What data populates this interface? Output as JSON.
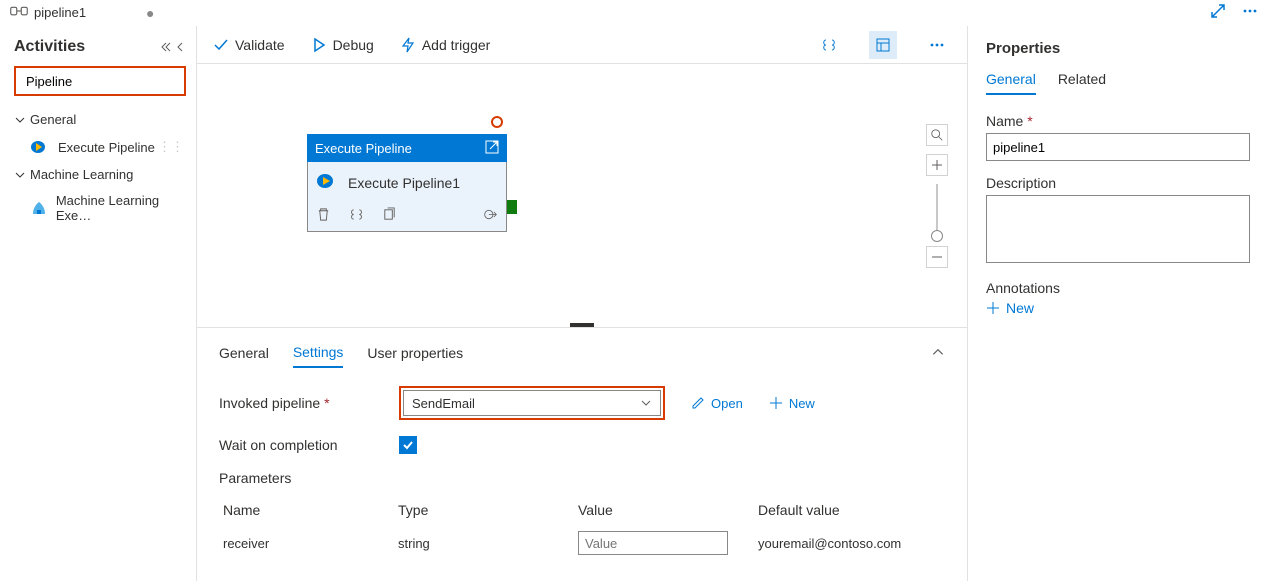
{
  "tab": {
    "title": "pipeline1"
  },
  "topActions": {
    "expand": "expand",
    "more": "more"
  },
  "sidebar": {
    "title": "Activities",
    "search_value": "Pipeline",
    "groups": [
      {
        "label": "General",
        "items": [
          {
            "label": "Execute Pipeline"
          }
        ]
      },
      {
        "label": "Machine Learning",
        "items": [
          {
            "label": "Machine Learning Exe…"
          }
        ]
      }
    ]
  },
  "toolbar": {
    "validate": "Validate",
    "debug": "Debug",
    "add_trigger": "Add trigger"
  },
  "canvas": {
    "node": {
      "type_label": "Execute Pipeline",
      "name": "Execute Pipeline1"
    }
  },
  "settings": {
    "tabs": {
      "general": "General",
      "settings": "Settings",
      "user_props": "User properties"
    },
    "invoked_label": "Invoked pipeline",
    "invoked_value": "SendEmail",
    "open": "Open",
    "new": "New",
    "wait_label": "Wait on completion",
    "wait_checked": true,
    "params_label": "Parameters",
    "columns": {
      "name": "Name",
      "type": "Type",
      "value": "Value",
      "default": "Default value"
    },
    "rows": [
      {
        "name": "receiver",
        "type": "string",
        "value_placeholder": "Value",
        "default": "youremail@contoso.com"
      }
    ]
  },
  "props": {
    "title": "Properties",
    "tabs": {
      "general": "General",
      "related": "Related"
    },
    "name_label": "Name",
    "name_value": "pipeline1",
    "desc_label": "Description",
    "desc_value": "",
    "annotations_label": "Annotations",
    "new": "New"
  }
}
